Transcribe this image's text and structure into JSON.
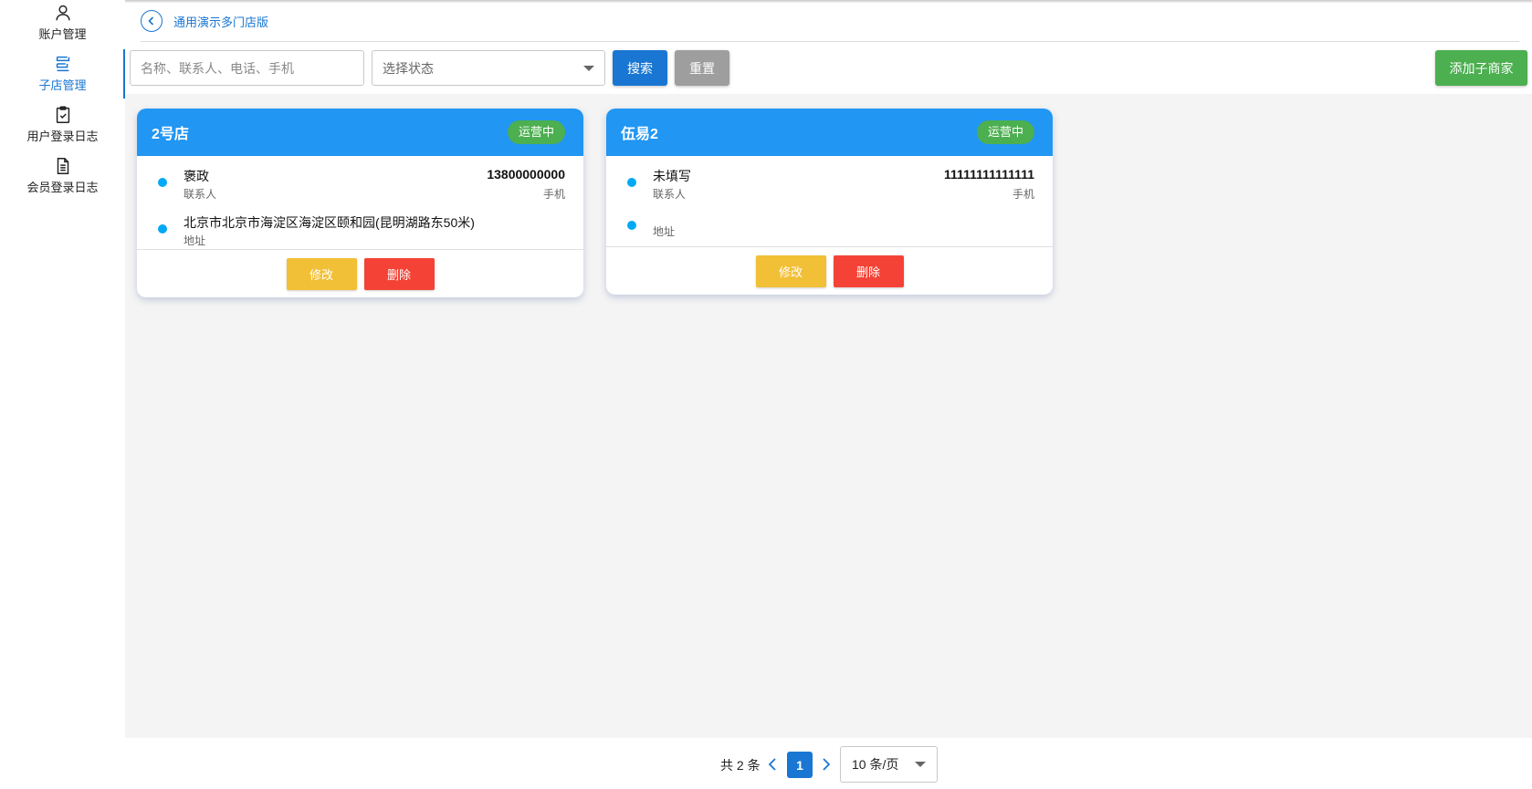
{
  "sidebar": {
    "items": [
      {
        "label": "账户管理",
        "icon": "user-icon",
        "active": false
      },
      {
        "label": "子店管理",
        "icon": "store-list-icon",
        "active": true
      },
      {
        "label": "用户登录日志",
        "icon": "clipboard-check-icon",
        "active": false
      },
      {
        "label": "会员登录日志",
        "icon": "document-icon",
        "active": false
      }
    ]
  },
  "header": {
    "breadcrumb": "通用演示多门店版"
  },
  "toolbar": {
    "search_placeholder": "名称、联系人、电话、手机",
    "status_placeholder": "选择状态",
    "search_label": "搜索",
    "reset_label": "重置",
    "add_label": "添加子商家"
  },
  "stores": [
    {
      "name": "2号店",
      "status": "运营中",
      "contact": "褒政",
      "contact_label": "联系人",
      "phone": "13800000000",
      "phone_label": "手机",
      "address": "北京市北京市海淀区海淀区颐和园(昆明湖路东50米)",
      "address_label": "地址",
      "edit_label": "修改",
      "delete_label": "删除"
    },
    {
      "name": "伍易2",
      "status": "运营中",
      "contact": "未填写",
      "contact_label": "联系人",
      "phone": "11111111111111",
      "phone_label": "手机",
      "address": "",
      "address_label": "地址",
      "edit_label": "修改",
      "delete_label": "删除"
    }
  ],
  "pagination": {
    "total_text": "共 2 条",
    "current_page": "1",
    "per_page": "10 条/页"
  },
  "colors": {
    "primary": "#1976d2",
    "card_header": "#2196f3",
    "status_green": "#4caf50",
    "edit_yellow": "#f2c037",
    "delete_red": "#f44336",
    "reset_gray": "#9e9e9e"
  }
}
